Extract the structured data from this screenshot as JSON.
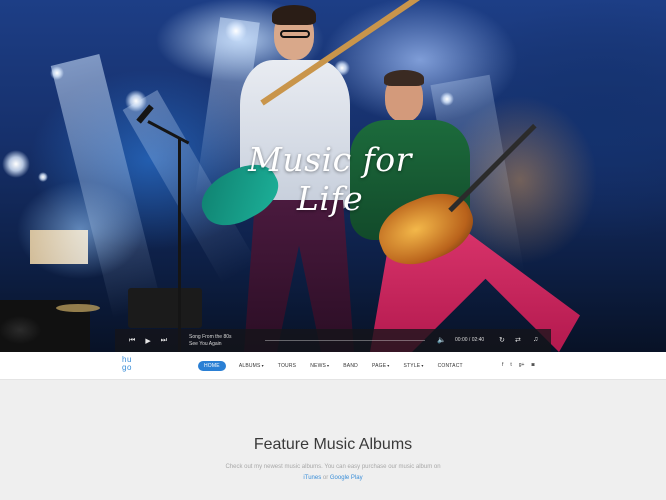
{
  "hero": {
    "title": "Music for Life"
  },
  "player": {
    "prev_icon": "skip-back-icon",
    "play_icon": "play-icon",
    "next_icon": "skip-forward-icon",
    "track_title": "Song From the 80s",
    "track_subtitle": "See You Again",
    "current_time": "00:00",
    "separator": "/",
    "duration": "02:40",
    "progress": 0
  },
  "nav": {
    "logo_top": "hu",
    "logo_bottom": "go",
    "items": [
      {
        "label": "HOME",
        "active": true,
        "dropdown": false
      },
      {
        "label": "ALBUMS",
        "active": false,
        "dropdown": true
      },
      {
        "label": "TOURS",
        "active": false,
        "dropdown": false
      },
      {
        "label": "NEWS",
        "active": false,
        "dropdown": true
      },
      {
        "label": "BAND",
        "active": false,
        "dropdown": false
      },
      {
        "label": "PAGE",
        "active": false,
        "dropdown": true
      },
      {
        "label": "STYLE",
        "active": false,
        "dropdown": true
      },
      {
        "label": "CONTACT",
        "active": false,
        "dropdown": false
      }
    ],
    "social": [
      {
        "icon": "facebook-icon",
        "glyph": "f"
      },
      {
        "icon": "twitter-icon",
        "glyph": "t"
      },
      {
        "icon": "google-plus-icon",
        "glyph": "g+"
      },
      {
        "icon": "instagram-icon",
        "glyph": "◙"
      }
    ]
  },
  "section": {
    "title": "Feature Music Albums",
    "desc_line1": "Check out my newest music albums. You can easy purchase our music album on",
    "link_itunes": "iTunes",
    "or_text": " or ",
    "link_google": "Google Play"
  },
  "colors": {
    "accent": "#2a7fd4",
    "background": "#efefef"
  }
}
